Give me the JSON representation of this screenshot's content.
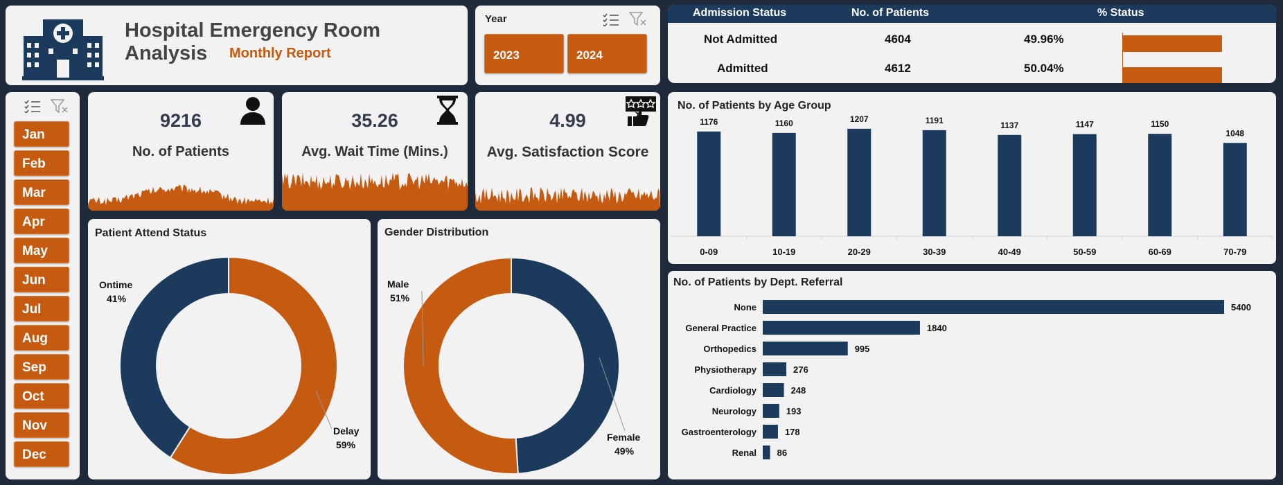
{
  "header": {
    "title": "Hospital Emergency Room Analysis",
    "subtitle": "Monthly Report",
    "logo_icon": "hospital-icon"
  },
  "year_slicer": {
    "title": "Year",
    "years": [
      "2023",
      "2024"
    ],
    "icons": [
      "multi-select-icon",
      "clear-filter-icon"
    ]
  },
  "month_slicer": {
    "months": [
      "Jan",
      "Feb",
      "Mar",
      "Apr",
      "May",
      "Jun",
      "Jul",
      "Aug",
      "Sep",
      "Oct",
      "Nov",
      "Dec"
    ],
    "icons": [
      "multi-select-icon",
      "clear-filter-icon"
    ]
  },
  "kpis": [
    {
      "value": "9216",
      "label": "No. of Patients",
      "icon": "person-icon"
    },
    {
      "value": "35.26",
      "label": "Avg. Wait Time (Mins.)",
      "icon": "hourglass-icon"
    },
    {
      "value": "4.99",
      "label": "Avg. Satisfaction Score",
      "icon": "rating-thumbs-up-icon"
    }
  ],
  "colors": {
    "accent": "#c55a11",
    "navy": "#1b3a5c",
    "background": "#1f2b3b",
    "card": "#f2f2f2"
  },
  "chart_data": [
    {
      "type": "table",
      "columns": [
        "Admission Status",
        "No. of Patients",
        "% Status"
      ],
      "rows": [
        {
          "status": "Not Admitted",
          "patients": "4604",
          "pct": "49.96%",
          "pct_value": 49.96
        },
        {
          "status": "Admitted",
          "patients": "4612",
          "pct": "50.04%",
          "pct_value": 50.04
        }
      ]
    },
    {
      "type": "bar",
      "title": "No. of Patients by Age Group",
      "categories": [
        "0-09",
        "10-19",
        "20-29",
        "30-39",
        "40-49",
        "50-59",
        "60-69",
        "70-79"
      ],
      "values": [
        1176,
        1160,
        1207,
        1191,
        1137,
        1147,
        1150,
        1048
      ]
    },
    {
      "type": "bar",
      "orientation": "horizontal",
      "title": "No. of Patients by Dept. Referral",
      "categories": [
        "None",
        "General Practice",
        "Orthopedics",
        "Physiotherapy",
        "Cardiology",
        "Neurology",
        "Gastroenterology",
        "Renal"
      ],
      "values": [
        5400,
        1840,
        995,
        276,
        248,
        193,
        178,
        86
      ]
    },
    {
      "type": "pie",
      "title": "Patient Attend Status",
      "slices": [
        {
          "label": "Delay",
          "pct_label": "59%",
          "value": 59,
          "color": "#c55a11"
        },
        {
          "label": "Ontime",
          "pct_label": "41%",
          "value": 41,
          "color": "#1b3a5c"
        }
      ]
    },
    {
      "type": "pie",
      "title": "Gender Distribution",
      "slices": [
        {
          "label": "Female",
          "pct_label": "49%",
          "value": 49,
          "color": "#1b3a5c"
        },
        {
          "label": "Male",
          "pct_label": "51%",
          "value": 51,
          "color": "#c55a11"
        }
      ]
    }
  ]
}
